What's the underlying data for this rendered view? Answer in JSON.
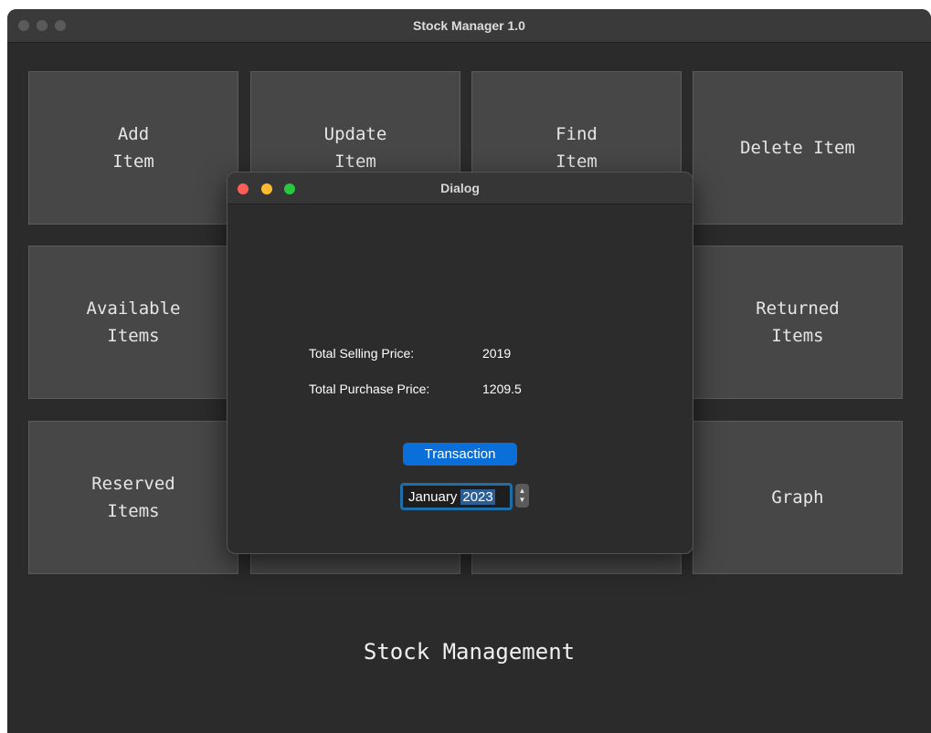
{
  "main_window": {
    "title": "Stock Manager 1.0",
    "tiles": [
      {
        "label": "Add\nItem"
      },
      {
        "label": "Update\nItem"
      },
      {
        "label": "Find\nItem"
      },
      {
        "label": "Delete Item"
      },
      {
        "label": "Available\nItems"
      },
      {
        "label": "Returned\nItems"
      },
      {
        "label": "Reserved\nItems"
      },
      {
        "label": "Graph"
      }
    ],
    "footer": "Stock Management"
  },
  "dialog": {
    "title": "Dialog",
    "total_selling_label": "Total Selling Price:",
    "total_selling_value": "2019",
    "total_purchase_label": "Total Purchase Price:",
    "total_purchase_value": "1209.5",
    "transaction_button": "Transaction",
    "date_month": "January",
    "date_year": "2023"
  },
  "colors": {
    "accent": "#0a6fd9",
    "window_bg": "#2b2b2b",
    "tile_bg": "#474747"
  },
  "icons": [
    "close-icon",
    "minimize-icon",
    "zoom-icon",
    "stepper-icon"
  ]
}
